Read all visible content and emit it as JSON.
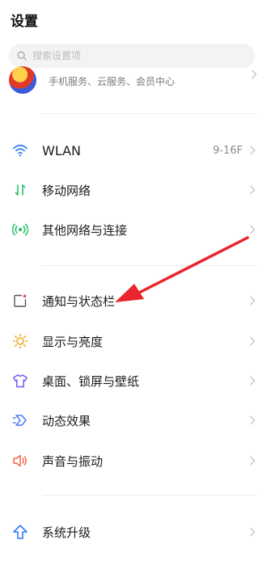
{
  "header": {
    "title": "设置"
  },
  "search": {
    "placeholder": "搜索设置项"
  },
  "account": {
    "subtitle": "手机服务、云服务、会员中心"
  },
  "items": [
    {
      "label": "WLAN",
      "value": "9-16F",
      "icon": "wifi-icon",
      "color": "#2f7cf6"
    },
    {
      "label": "移动网络",
      "icon": "mobile-data-icon",
      "color": "#2cc06c"
    },
    {
      "label": "其他网络与连接",
      "icon": "connection-icon",
      "color": "#2cc06c"
    },
    {
      "label": "通知与状态栏",
      "icon": "notification-icon",
      "color": "#e84848"
    },
    {
      "label": "显示与亮度",
      "icon": "brightness-icon",
      "color": "#f3a51f"
    },
    {
      "label": "桌面、锁屏与壁纸",
      "icon": "shirt-icon",
      "color": "#6b5cf0"
    },
    {
      "label": "动态效果",
      "icon": "motion-effect-icon",
      "color": "#4a79f5"
    },
    {
      "label": "声音与振动",
      "icon": "sound-icon",
      "color": "#f06a4d"
    },
    {
      "label": "系统升级",
      "icon": "upgrade-icon",
      "color": "#2f7cf6"
    }
  ],
  "annotation": {
    "color": "#e8262c"
  }
}
